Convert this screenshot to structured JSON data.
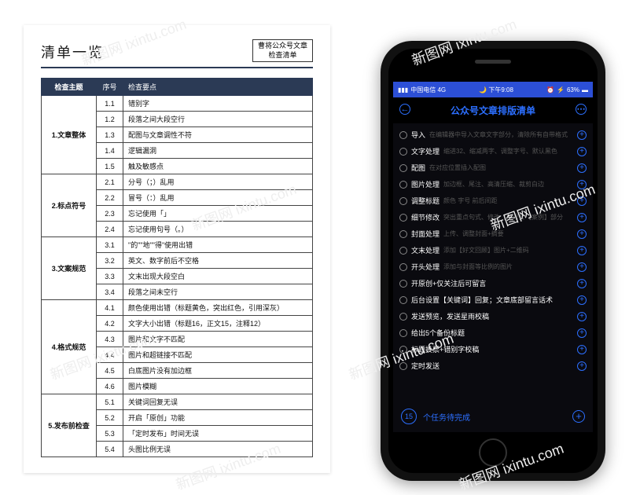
{
  "doc": {
    "title": "清单一览",
    "badge_line1": "曹将公众号文章",
    "badge_line2": "检查清单",
    "headers": [
      "检查主题",
      "序号",
      "检查要点"
    ],
    "sections": [
      {
        "theme": "1.文章整体",
        "rows": [
          {
            "num": "1.1",
            "point": "错别字"
          },
          {
            "num": "1.2",
            "point": "段落之间大段空行"
          },
          {
            "num": "1.3",
            "point": "配图与文章调性不符"
          },
          {
            "num": "1.4",
            "point": "逻辑漏洞"
          },
          {
            "num": "1.5",
            "point": "触及敏感点"
          }
        ]
      },
      {
        "theme": "2.标点符号",
        "rows": [
          {
            "num": "2.1",
            "point": "分号（；）乱用"
          },
          {
            "num": "2.2",
            "point": "冒号（：）乱用"
          },
          {
            "num": "2.3",
            "point": "忘记使用「」"
          },
          {
            "num": "2.4",
            "point": "忘记使用句号（。）"
          }
        ]
      },
      {
        "theme": "3.文案规范",
        "rows": [
          {
            "num": "3.1",
            "point": "\"的\"\"地\"\"得\"使用出错"
          },
          {
            "num": "3.2",
            "point": "英文、数字前后不空格"
          },
          {
            "num": "3.3",
            "point": "文末出现大段空白"
          },
          {
            "num": "3.4",
            "point": "段落之间未空行"
          }
        ]
      },
      {
        "theme": "4.格式规范",
        "rows": [
          {
            "num": "4.1",
            "point": "颜色使用出错（标题黄色，突出红色，引用深灰）"
          },
          {
            "num": "4.2",
            "point": "文字大小出错（标题16，正文15，注释12）"
          },
          {
            "num": "4.3",
            "point": "图片和文字不匹配"
          },
          {
            "num": "4.4",
            "point": "图片和超链接不匹配"
          },
          {
            "num": "4.5",
            "point": "白底图片没有加边框"
          },
          {
            "num": "4.6",
            "point": "图片模糊"
          }
        ]
      },
      {
        "theme": "5.发布前检查",
        "rows": [
          {
            "num": "5.1",
            "point": "关键词回复无误"
          },
          {
            "num": "5.2",
            "point": "开启「原创」功能"
          },
          {
            "num": "5.3",
            "point": "「定时发布」时间无误"
          },
          {
            "num": "5.4",
            "point": "头图比例无误"
          }
        ]
      }
    ]
  },
  "phone": {
    "statusbar": {
      "carrier": "中国电信 4G",
      "time": "下午9:08",
      "battery": "63%"
    },
    "title": "公众号文章排版清单",
    "items": [
      {
        "label": "导入",
        "desc": "在编辑器中导入文章文字部分，清除所有自带格式"
      },
      {
        "label": "文字处理",
        "desc": "缩进32、缩减两字、调整字号、默认黑色"
      },
      {
        "label": "配图",
        "desc": "在对应位置插入配图"
      },
      {
        "label": "图片处理",
        "desc": "加边框、尾注、高清压缩、裁剪白边"
      },
      {
        "label": "调整标题",
        "desc": "颜色 字号 前后间距"
      },
      {
        "label": "细节修改",
        "desc": "突出重点句式、修改【序号】、【案例】部分"
      },
      {
        "label": "封面处理",
        "desc": "上传、调整封面+摘要"
      },
      {
        "label": "文末处理",
        "desc": "添加【好文回顾】图片+二维码"
      },
      {
        "label": "开头处理",
        "desc": "添加与封面等比例的图片"
      },
      {
        "label": "开原创+仅关注后可留言",
        "desc": ""
      },
      {
        "label": "后台设置【关键词】回复；文章底部留言话术",
        "desc": ""
      },
      {
        "label": "发送预览，发送星雨校稿",
        "desc": ""
      },
      {
        "label": "给出5个备份标题",
        "desc": ""
      },
      {
        "label": "标题投票+错别字校稿",
        "desc": ""
      },
      {
        "label": "定时发送",
        "desc": ""
      }
    ],
    "footer_count": "15",
    "footer_text": "个任务待完成"
  },
  "watermark": "新图网 ixintu.com"
}
